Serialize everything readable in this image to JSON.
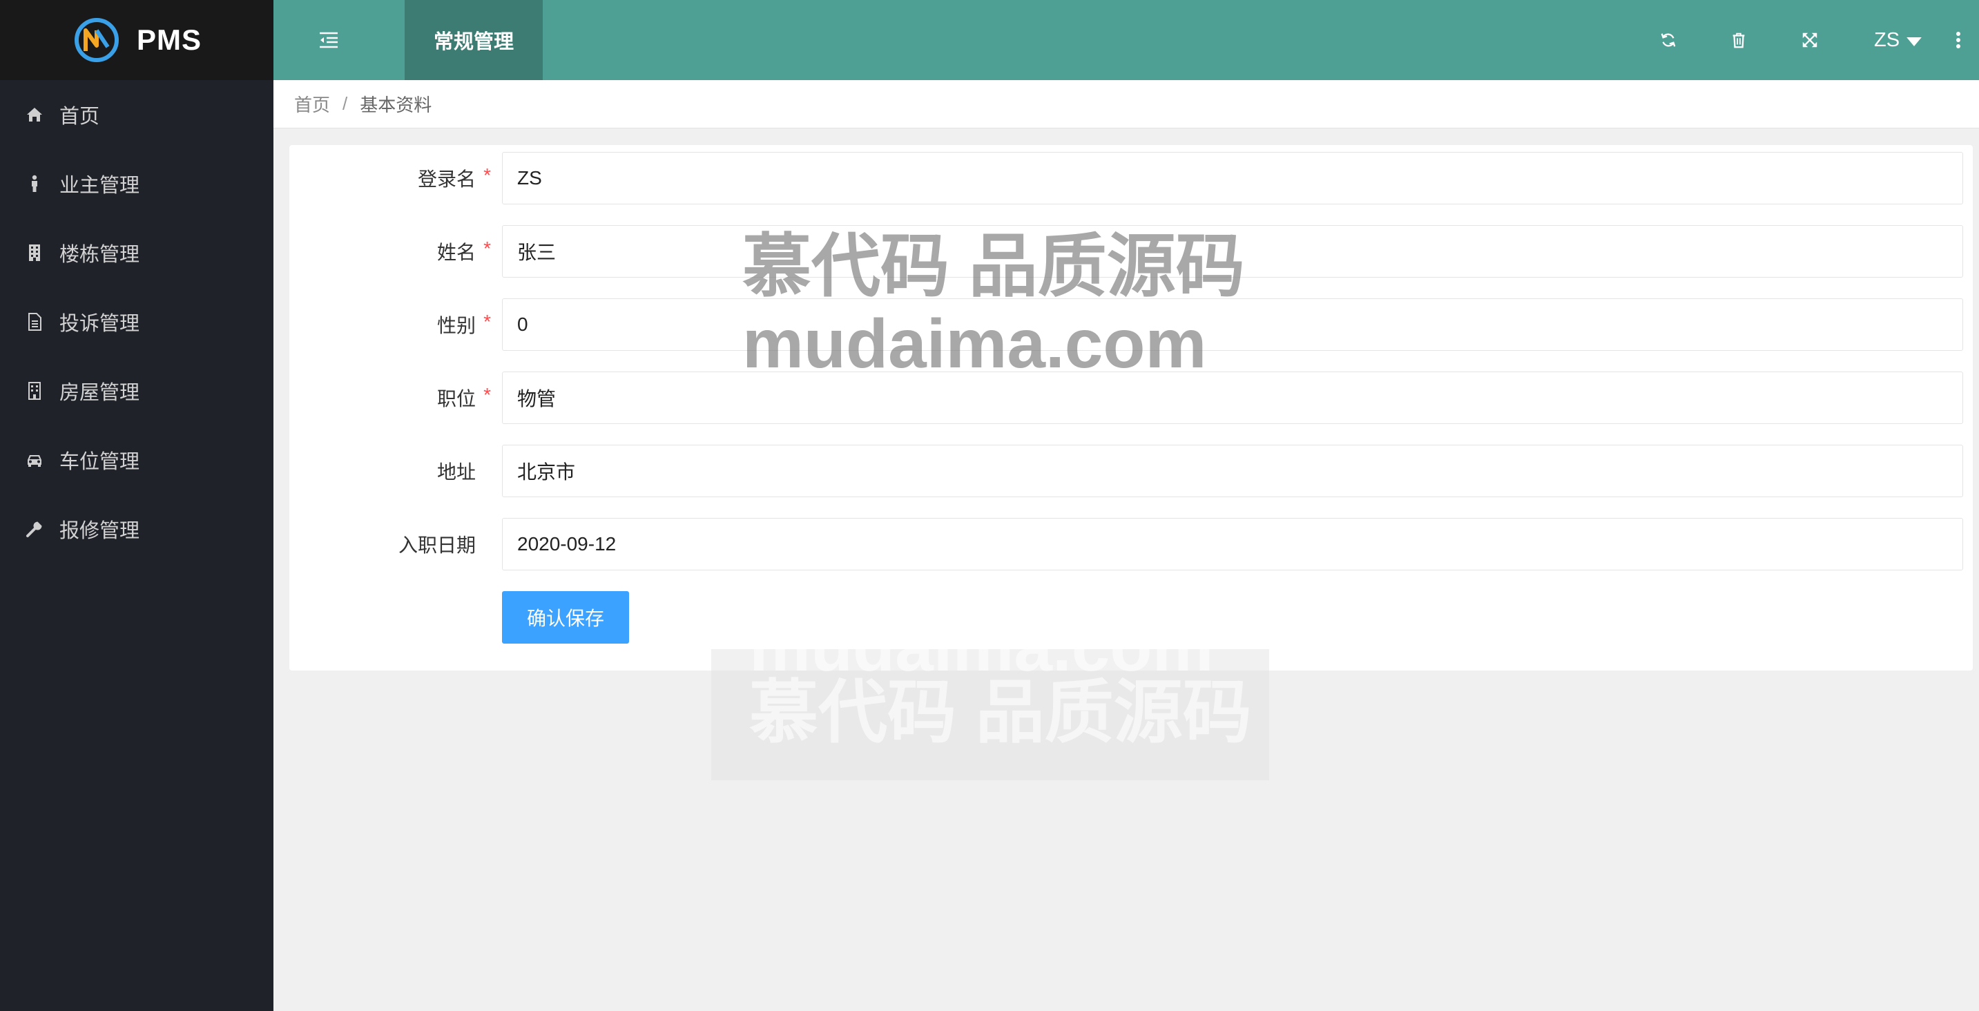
{
  "app": {
    "logo_text": "PMS"
  },
  "sidebar": {
    "items": [
      {
        "label": "首页",
        "icon": "home-icon"
      },
      {
        "label": "业主管理",
        "icon": "person-icon"
      },
      {
        "label": "楼栋管理",
        "icon": "building-icon"
      },
      {
        "label": "投诉管理",
        "icon": "document-icon"
      },
      {
        "label": "房屋管理",
        "icon": "house-icon"
      },
      {
        "label": "车位管理",
        "icon": "car-icon"
      },
      {
        "label": "报修管理",
        "icon": "wrench-icon"
      }
    ]
  },
  "header": {
    "active_tab": "常规管理",
    "user": "ZS",
    "icons": [
      "menu-toggle-icon",
      "refresh-icon",
      "trash-icon",
      "fullscreen-icon",
      "more-vertical-icon"
    ]
  },
  "breadcrumb": {
    "home": "首页",
    "separator": "/",
    "current": "基本资料"
  },
  "form": {
    "fields": [
      {
        "label": "登录名",
        "required": true,
        "value": "ZS"
      },
      {
        "label": "姓名",
        "required": true,
        "value": "张三"
      },
      {
        "label": "性别",
        "required": true,
        "value": "0"
      },
      {
        "label": "职位",
        "required": true,
        "value": "物管"
      },
      {
        "label": "地址",
        "required": false,
        "value": "北京市"
      },
      {
        "label": "入职日期",
        "required": false,
        "value": "2020-09-12"
      }
    ],
    "required_mark": "*",
    "submit_label": "确认保存"
  },
  "watermark": {
    "line1": "慕代码 品质源码",
    "line2": "mudaima.com"
  },
  "colors": {
    "header": "#4ea095",
    "active_tab": "#3c7c73",
    "sidebar": "#20222a",
    "logo_bar": "#191919",
    "primary_button": "#3ba3ff",
    "required": "#ff4d4f"
  }
}
